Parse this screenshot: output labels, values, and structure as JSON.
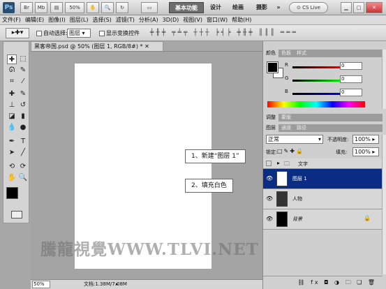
{
  "titlebar": {
    "logo": "Ps",
    "br": "Br",
    "mb": "Mb",
    "zoom": "50%",
    "workspaces": [
      "基本功能",
      "设计",
      "绘画",
      "摄影"
    ],
    "more": "»",
    "cslive": "CS Live"
  },
  "menu": [
    "文件(F)",
    "编辑(E)",
    "图像(I)",
    "图层(L)",
    "选择(S)",
    "滤镜(T)",
    "分析(A)",
    "3D(D)",
    "视图(V)",
    "窗口(W)",
    "帮助(H)"
  ],
  "options": {
    "auto_select_label": "自动选择:",
    "auto_select_value": "图层",
    "show_transform_label": "显示变换控件"
  },
  "document": {
    "tab_title": "黑客帝国.psd @ 50% (图层 1, RGB/8#) *",
    "zoom": "50%",
    "doc_info": "文档:1.38M/7.08M",
    "callouts": [
      "1、新建“图层 1”",
      "2、填充白色"
    ],
    "watermark": "騰龍視覺WWW.TLVI.NET"
  },
  "color_panel": {
    "tabs": [
      "颜色",
      "色板",
      "样式"
    ],
    "sliders": [
      {
        "label": "R",
        "value": "0"
      },
      {
        "label": "G",
        "value": "0"
      },
      {
        "label": "B",
        "value": "0"
      }
    ]
  },
  "adjust_panel": {
    "tabs": [
      "调整",
      "蒙版"
    ]
  },
  "layers_panel": {
    "tabs": [
      "图层",
      "通道",
      "路径"
    ],
    "blend_mode": "正常",
    "opacity_label": "不透明度:",
    "opacity_value": "100%",
    "lock_label": "锁定:",
    "fill_label": "填充:",
    "fill_value": "100%",
    "layers": [
      {
        "name": "文字",
        "type": "group"
      },
      {
        "name": "图层 1",
        "type": "layer",
        "selected": true
      },
      {
        "name": "人物",
        "type": "layer"
      },
      {
        "name": "背景",
        "type": "background"
      }
    ]
  },
  "colors": {
    "accent": "#1e3f91",
    "selected_layer": "#0a2c82"
  }
}
